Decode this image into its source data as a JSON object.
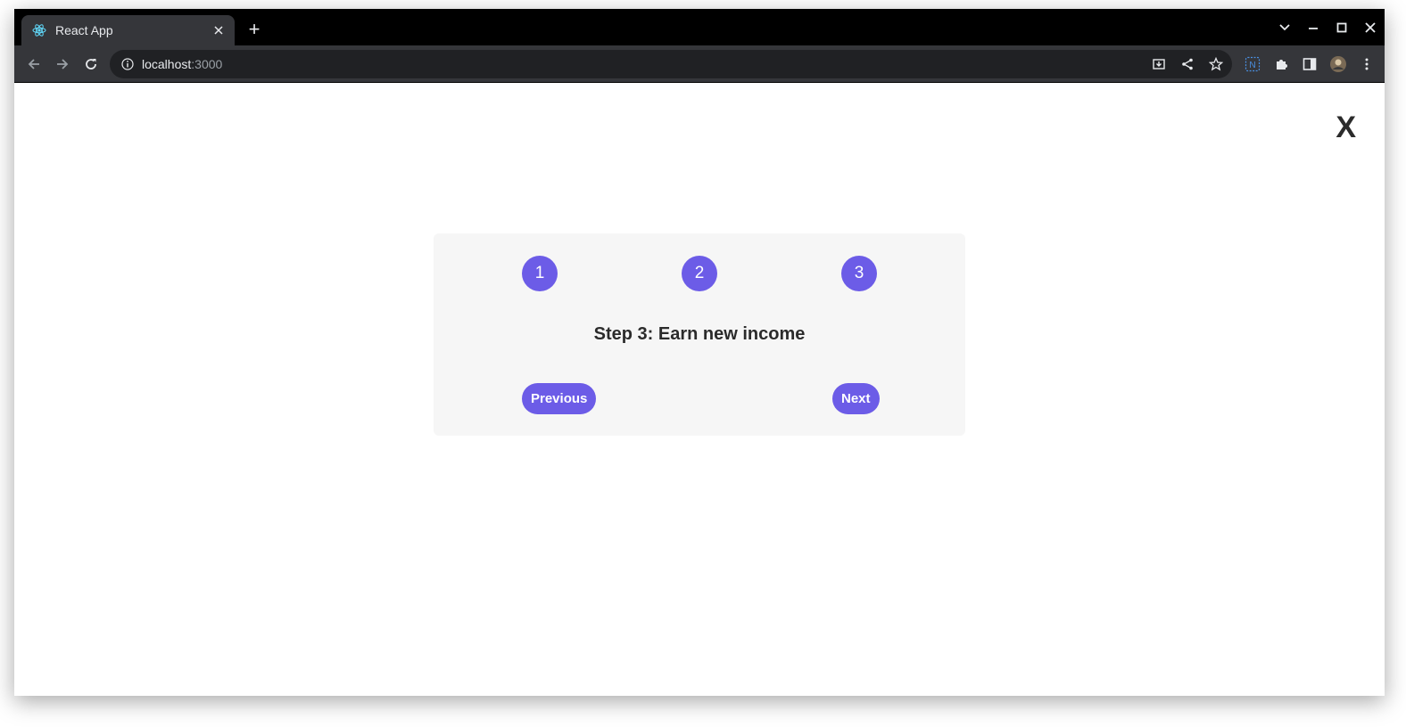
{
  "browser": {
    "tab_title": "React App",
    "new_tab_symbol": "+",
    "url_host": "localhost",
    "url_port": ":3000"
  },
  "page": {
    "close_label": "X",
    "steps": [
      "1",
      "2",
      "3"
    ],
    "step_title": "Step 3: Earn new income",
    "previous_label": "Previous",
    "next_label": "Next"
  },
  "colors": {
    "accent": "#6c5ce7",
    "card_bg": "#f6f6f6"
  },
  "icons": {
    "favicon": "react-icon",
    "tab_close": "close-icon",
    "back": "back-arrow-icon",
    "forward": "forward-arrow-icon",
    "reload": "reload-icon",
    "site_info": "info-icon",
    "install": "install-icon",
    "share": "share-icon",
    "bookmark": "star-icon",
    "extension_n": "notion-extension-icon",
    "extensions": "puzzle-icon",
    "side_panel": "side-panel-icon",
    "profile": "avatar",
    "menu": "kebab-menu-icon"
  }
}
